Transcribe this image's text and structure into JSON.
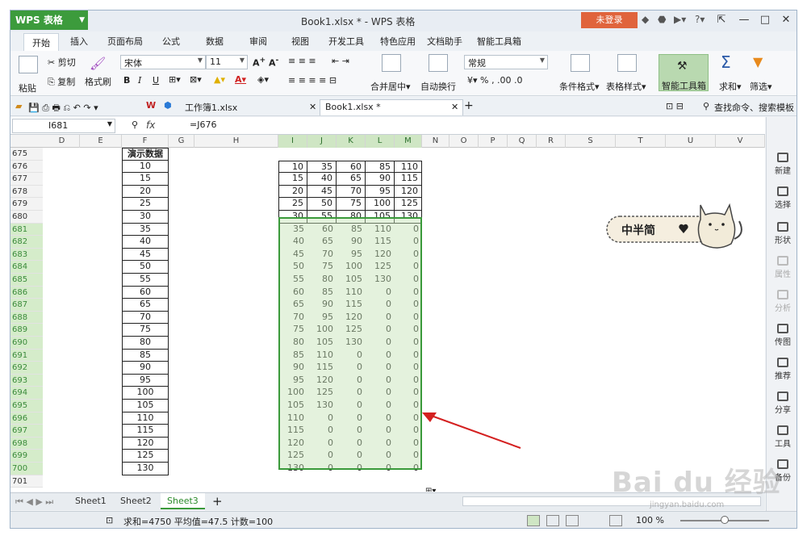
{
  "titlebar": {
    "app_button": "WPS 表格",
    "doc_title": "Book1.xlsx * - WPS 表格",
    "login": "未登录"
  },
  "menu": [
    "开始",
    "插入",
    "页面布局",
    "公式",
    "数据",
    "审阅",
    "视图",
    "开发工具",
    "特色应用",
    "文档助手",
    "智能工具箱"
  ],
  "ribbon": {
    "paste": "粘贴",
    "cut": "剪切",
    "copy": "复制",
    "format_painter": "格式刷",
    "font_name": "宋体",
    "font_size": "11",
    "merge_center": "合并居中",
    "wrap_text": "自动换行",
    "number_format": "常规",
    "conditional_format": "条件格式",
    "table_style": "表格样式",
    "smart_toolbox": "智能工具箱",
    "sum": "求和",
    "filter": "筛选"
  },
  "doctabs": {
    "tab1": "工作簿1.xlsx",
    "tab2": "Book1.xlsx *",
    "search": "查找命令、搜索模板"
  },
  "formula": {
    "namebox": "I681",
    "value": "=J676"
  },
  "columns": {
    "left": [
      [
        "D",
        42,
        44
      ],
      [
        "E",
        86,
        52
      ],
      [
        "F",
        138,
        58
      ],
      [
        "G",
        196,
        32
      ],
      [
        "H",
        228,
        104
      ]
    ],
    "data": [
      [
        "I",
        332,
        36
      ],
      [
        "J",
        368,
        36
      ],
      [
        "K",
        404,
        36
      ],
      [
        "L",
        440,
        36
      ],
      [
        "M",
        476,
        34
      ]
    ],
    "right": [
      [
        "N",
        510,
        34
      ],
      [
        "O",
        544,
        36
      ],
      [
        "P",
        580,
        36
      ],
      [
        "Q",
        616,
        36
      ],
      [
        "R",
        652,
        36
      ],
      [
        "S",
        688,
        62
      ],
      [
        "T",
        750,
        62
      ],
      [
        "U",
        812,
        62
      ],
      [
        "V",
        874,
        61
      ]
    ]
  },
  "rows": {
    "first": 675,
    "last": 701,
    "highlight_start": 681,
    "highlight_end": 700
  },
  "demo_header": "演示数据",
  "demo_values": [
    10,
    15,
    20,
    25,
    30,
    35,
    40,
    45,
    50,
    55,
    60,
    65,
    70,
    75,
    80,
    85,
    90,
    95,
    100,
    105,
    110,
    115,
    120,
    125,
    130
  ],
  "table_top": [
    [
      10,
      35,
      60,
      85,
      110
    ],
    [
      15,
      40,
      65,
      90,
      115
    ],
    [
      20,
      45,
      70,
      95,
      120
    ],
    [
      25,
      50,
      75,
      100,
      125
    ],
    [
      30,
      55,
      80,
      105,
      130
    ]
  ],
  "table_result": [
    [
      35,
      60,
      85,
      110,
      0
    ],
    [
      40,
      65,
      90,
      115,
      0
    ],
    [
      45,
      70,
      95,
      120,
      0
    ],
    [
      50,
      75,
      100,
      125,
      0
    ],
    [
      55,
      80,
      105,
      130,
      0
    ],
    [
      60,
      85,
      110,
      0,
      0
    ],
    [
      65,
      90,
      115,
      0,
      0
    ],
    [
      70,
      95,
      120,
      0,
      0
    ],
    [
      75,
      100,
      125,
      0,
      0
    ],
    [
      80,
      105,
      130,
      0,
      0
    ],
    [
      85,
      110,
      0,
      0,
      0
    ],
    [
      90,
      115,
      0,
      0,
      0
    ],
    [
      95,
      120,
      0,
      0,
      0
    ],
    [
      100,
      125,
      0,
      0,
      0
    ],
    [
      105,
      130,
      0,
      0,
      0
    ],
    [
      110,
      0,
      0,
      0,
      0
    ],
    [
      115,
      0,
      0,
      0,
      0
    ],
    [
      120,
      0,
      0,
      0,
      0
    ],
    [
      125,
      0,
      0,
      0,
      0
    ],
    [
      130,
      0,
      0,
      0,
      0
    ]
  ],
  "sticker_text": "中半简",
  "sidepanel": [
    "新建",
    "选择",
    "形状",
    "属性",
    "分析",
    "传图",
    "推荐",
    "分享",
    "工具",
    "备份"
  ],
  "sheets": [
    "Sheet1",
    "Sheet2",
    "Sheet3"
  ],
  "status": "求和=4750  平均值=47.5  计数=100",
  "zoom": "100 %",
  "watermark": "Bai du 经验",
  "watermark_url": "jingyan.baidu.com"
}
